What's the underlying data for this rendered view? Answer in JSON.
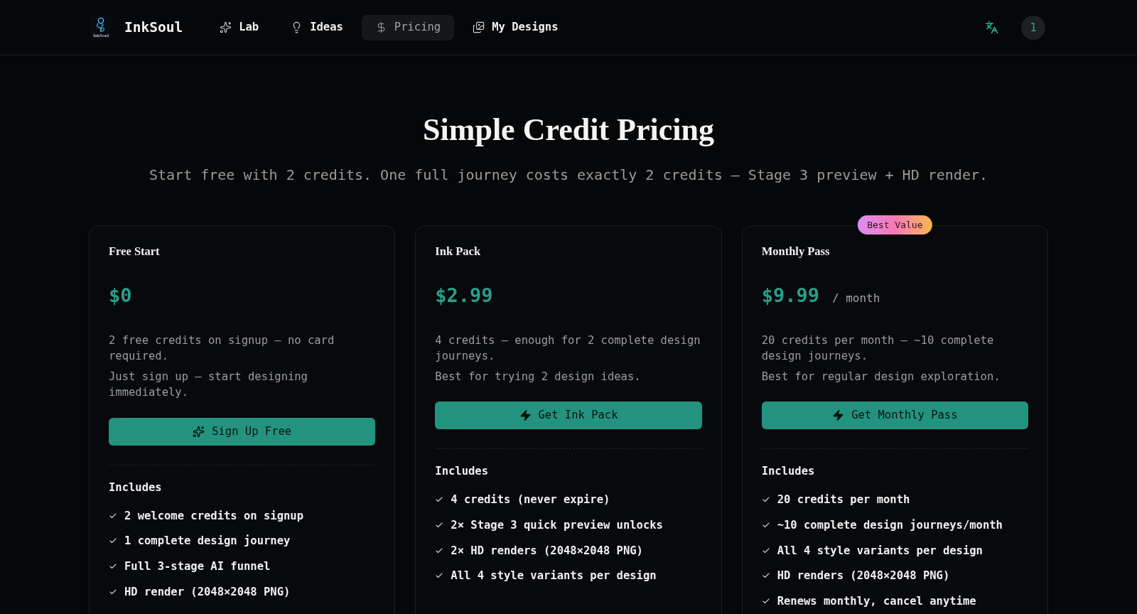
{
  "header": {
    "logo_caption": "InkSoul",
    "brand": "InkSoul",
    "nav": [
      {
        "label": "Lab",
        "selected": false
      },
      {
        "label": "Ideas",
        "selected": false
      },
      {
        "label": "Pricing",
        "selected": true
      },
      {
        "label": "My Designs",
        "selected": false
      }
    ],
    "avatar": "1"
  },
  "hero": {
    "title": "Simple Credit Pricing",
    "subtitle": "Start free with 2 credits. One full journey costs exactly 2 credits — Stage 3 preview + HD render."
  },
  "plans": [
    {
      "kind": "free",
      "name": "Free Start",
      "price": "$0",
      "description": [
        "2 free credits on signup — no card required.",
        "Just sign up — start designing immediately."
      ],
      "button": "Sign Up Free",
      "includes_title": "Includes",
      "features": [
        "2 welcome credits on signup",
        "1 complete design journey",
        "Full 3-stage AI funnel",
        "HD render (2048×2048 PNG)"
      ]
    },
    {
      "kind": "paid",
      "name": "Ink Pack",
      "price": "$2.99",
      "description": [
        "4 credits — enough for 2 complete design journeys.",
        "Best for trying 2 design ideas."
      ],
      "button": "Get Ink Pack",
      "includes_title": "Includes",
      "features": [
        "4 credits (never expire)",
        "2× Stage 3 quick preview unlocks",
        "2× HD renders (2048×2048 PNG)",
        "All 4 style variants per design"
      ]
    },
    {
      "kind": "paid",
      "name": "Monthly Pass",
      "badge": "Best Value",
      "price": "$9.99",
      "period": "/ month",
      "description": [
        "20 credits per month — ~10 complete design journeys.",
        "Best for regular design exploration."
      ],
      "button": "Get Monthly Pass",
      "includes_title": "Includes",
      "features": [
        "20 credits per month",
        "~10 complete design journeys/month",
        "All 4 style variants per design",
        "HD renders (2048×2048 PNG)",
        "Renews monthly, cancel anytime"
      ]
    }
  ]
}
